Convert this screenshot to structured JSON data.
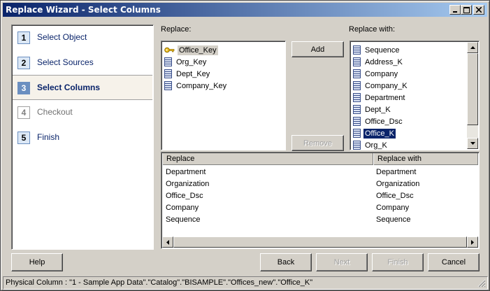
{
  "window": {
    "title": "Replace Wizard - Select Columns"
  },
  "steps": [
    {
      "num": "1",
      "label": "Select Object",
      "state": "normal"
    },
    {
      "num": "2",
      "label": "Select Sources",
      "state": "normal"
    },
    {
      "num": "3",
      "label": "Select Columns",
      "state": "active"
    },
    {
      "num": "4",
      "label": "Checkout",
      "state": "disabled"
    },
    {
      "num": "5",
      "label": "Finish",
      "state": "normal"
    }
  ],
  "replace": {
    "label": "Replace:",
    "items": [
      "Office_Key",
      "Org_Key",
      "Dept_Key",
      "Company_Key"
    ],
    "selected_index": 0
  },
  "replace_with": {
    "label": "Replace with:",
    "items": [
      "Sequence",
      "Address_K",
      "Company",
      "Company_K",
      "Department",
      "Dept_K",
      "Office_Dsc",
      "Office_K",
      "Org_K"
    ],
    "selected_index": 7
  },
  "buttons": {
    "add": "Add",
    "remove": "Remove",
    "help": "Help",
    "back": "Back",
    "next": "Next",
    "finish": "Finish",
    "cancel": "Cancel"
  },
  "mapping": {
    "columns": [
      "Replace",
      "Replace with"
    ],
    "rows": [
      [
        "Department",
        "Department"
      ],
      [
        "Organization",
        "Organization"
      ],
      [
        "Office_Dsc",
        "Office_Dsc"
      ],
      [
        "Company",
        "Company"
      ],
      [
        "Sequence",
        "Sequence"
      ]
    ]
  },
  "status": {
    "text": "Physical Column : \"1 - Sample App Data\".\"Catalog\".\"BISAMPLE\".\"Offices_new\".\"Office_K\""
  },
  "colors": {
    "title_start": "#0a246a",
    "title_end": "#a6caf0",
    "selection": "#0a246a",
    "step_active": "#6b8fc0"
  },
  "icons": {
    "key_column": "key-icon",
    "column": "column-icon"
  }
}
